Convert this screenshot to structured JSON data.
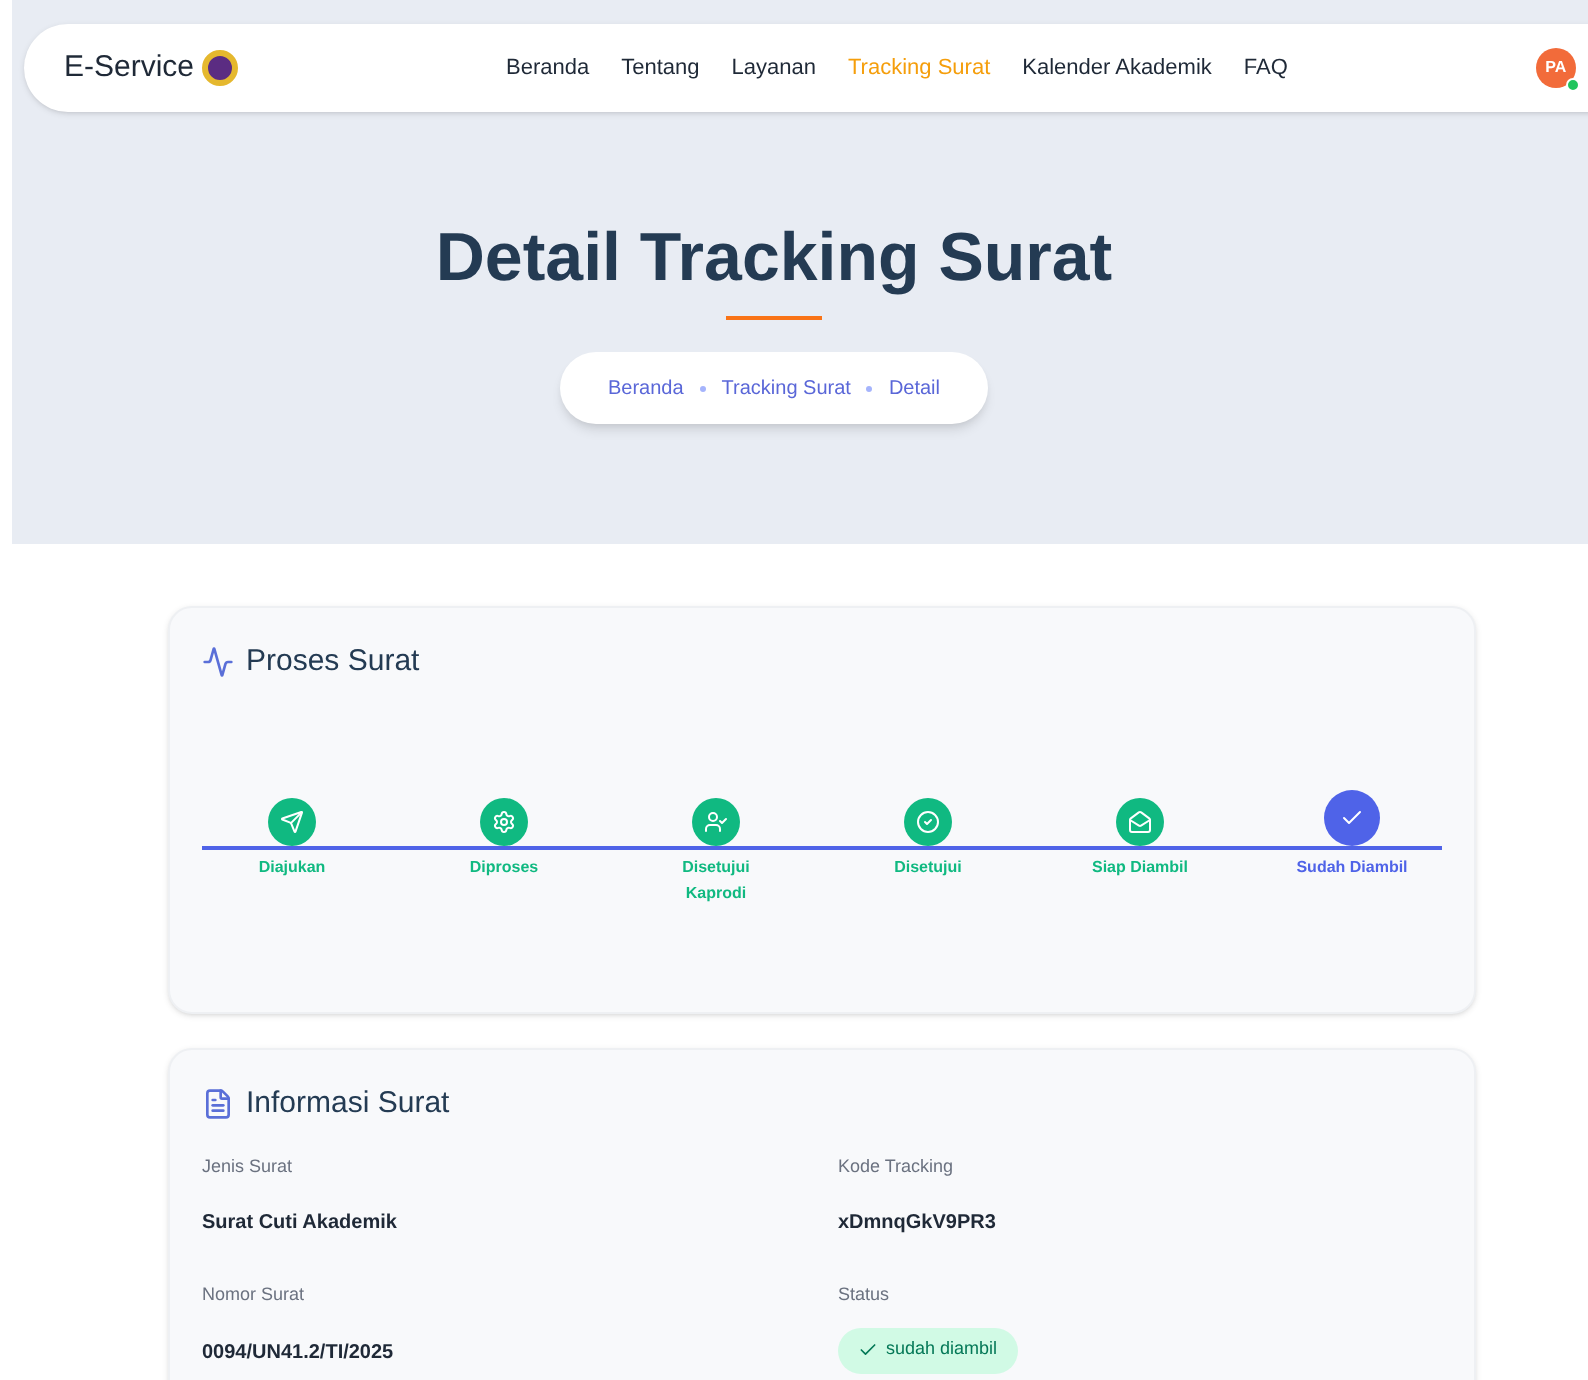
{
  "brand": {
    "name": "E-Service"
  },
  "nav": [
    {
      "label": "Beranda",
      "selected": false
    },
    {
      "label": "Tentang",
      "selected": false
    },
    {
      "label": "Layanan",
      "selected": false
    },
    {
      "label": "Tracking Surat",
      "selected": true
    },
    {
      "label": "Kalender Akademik",
      "selected": false
    },
    {
      "label": "FAQ",
      "selected": false
    }
  ],
  "user": {
    "initials": "PA",
    "online": true
  },
  "hero": {
    "title": "Detail Tracking Surat",
    "breadcrumb": [
      "Beranda",
      "Tracking Surat",
      "Detail"
    ]
  },
  "process": {
    "title": "Proses Surat",
    "steps": [
      {
        "label": "Diajukan",
        "kind": "send",
        "current": false
      },
      {
        "label": "Diproses",
        "kind": "gear",
        "current": false
      },
      {
        "label": "Disetujui Kaprodi",
        "kind": "user",
        "current": false
      },
      {
        "label": "Disetujui",
        "kind": "check",
        "current": false
      },
      {
        "label": "Siap Diambil",
        "kind": "mail",
        "current": false
      },
      {
        "label": "Sudah Diambil",
        "kind": "done",
        "current": true
      }
    ]
  },
  "info": {
    "title": "Informasi Surat",
    "fields": [
      {
        "label": "Jenis Surat",
        "value": "Surat Cuti Akademik",
        "kind": "text"
      },
      {
        "label": "Kode Tracking",
        "value": "xDmnqGkV9PR3",
        "kind": "text"
      },
      {
        "label": "Nomor Surat",
        "value": "0094/UN41.2/TI/2025",
        "kind": "text"
      },
      {
        "label": "Status",
        "value": "sudah diambil",
        "kind": "badge"
      }
    ]
  }
}
